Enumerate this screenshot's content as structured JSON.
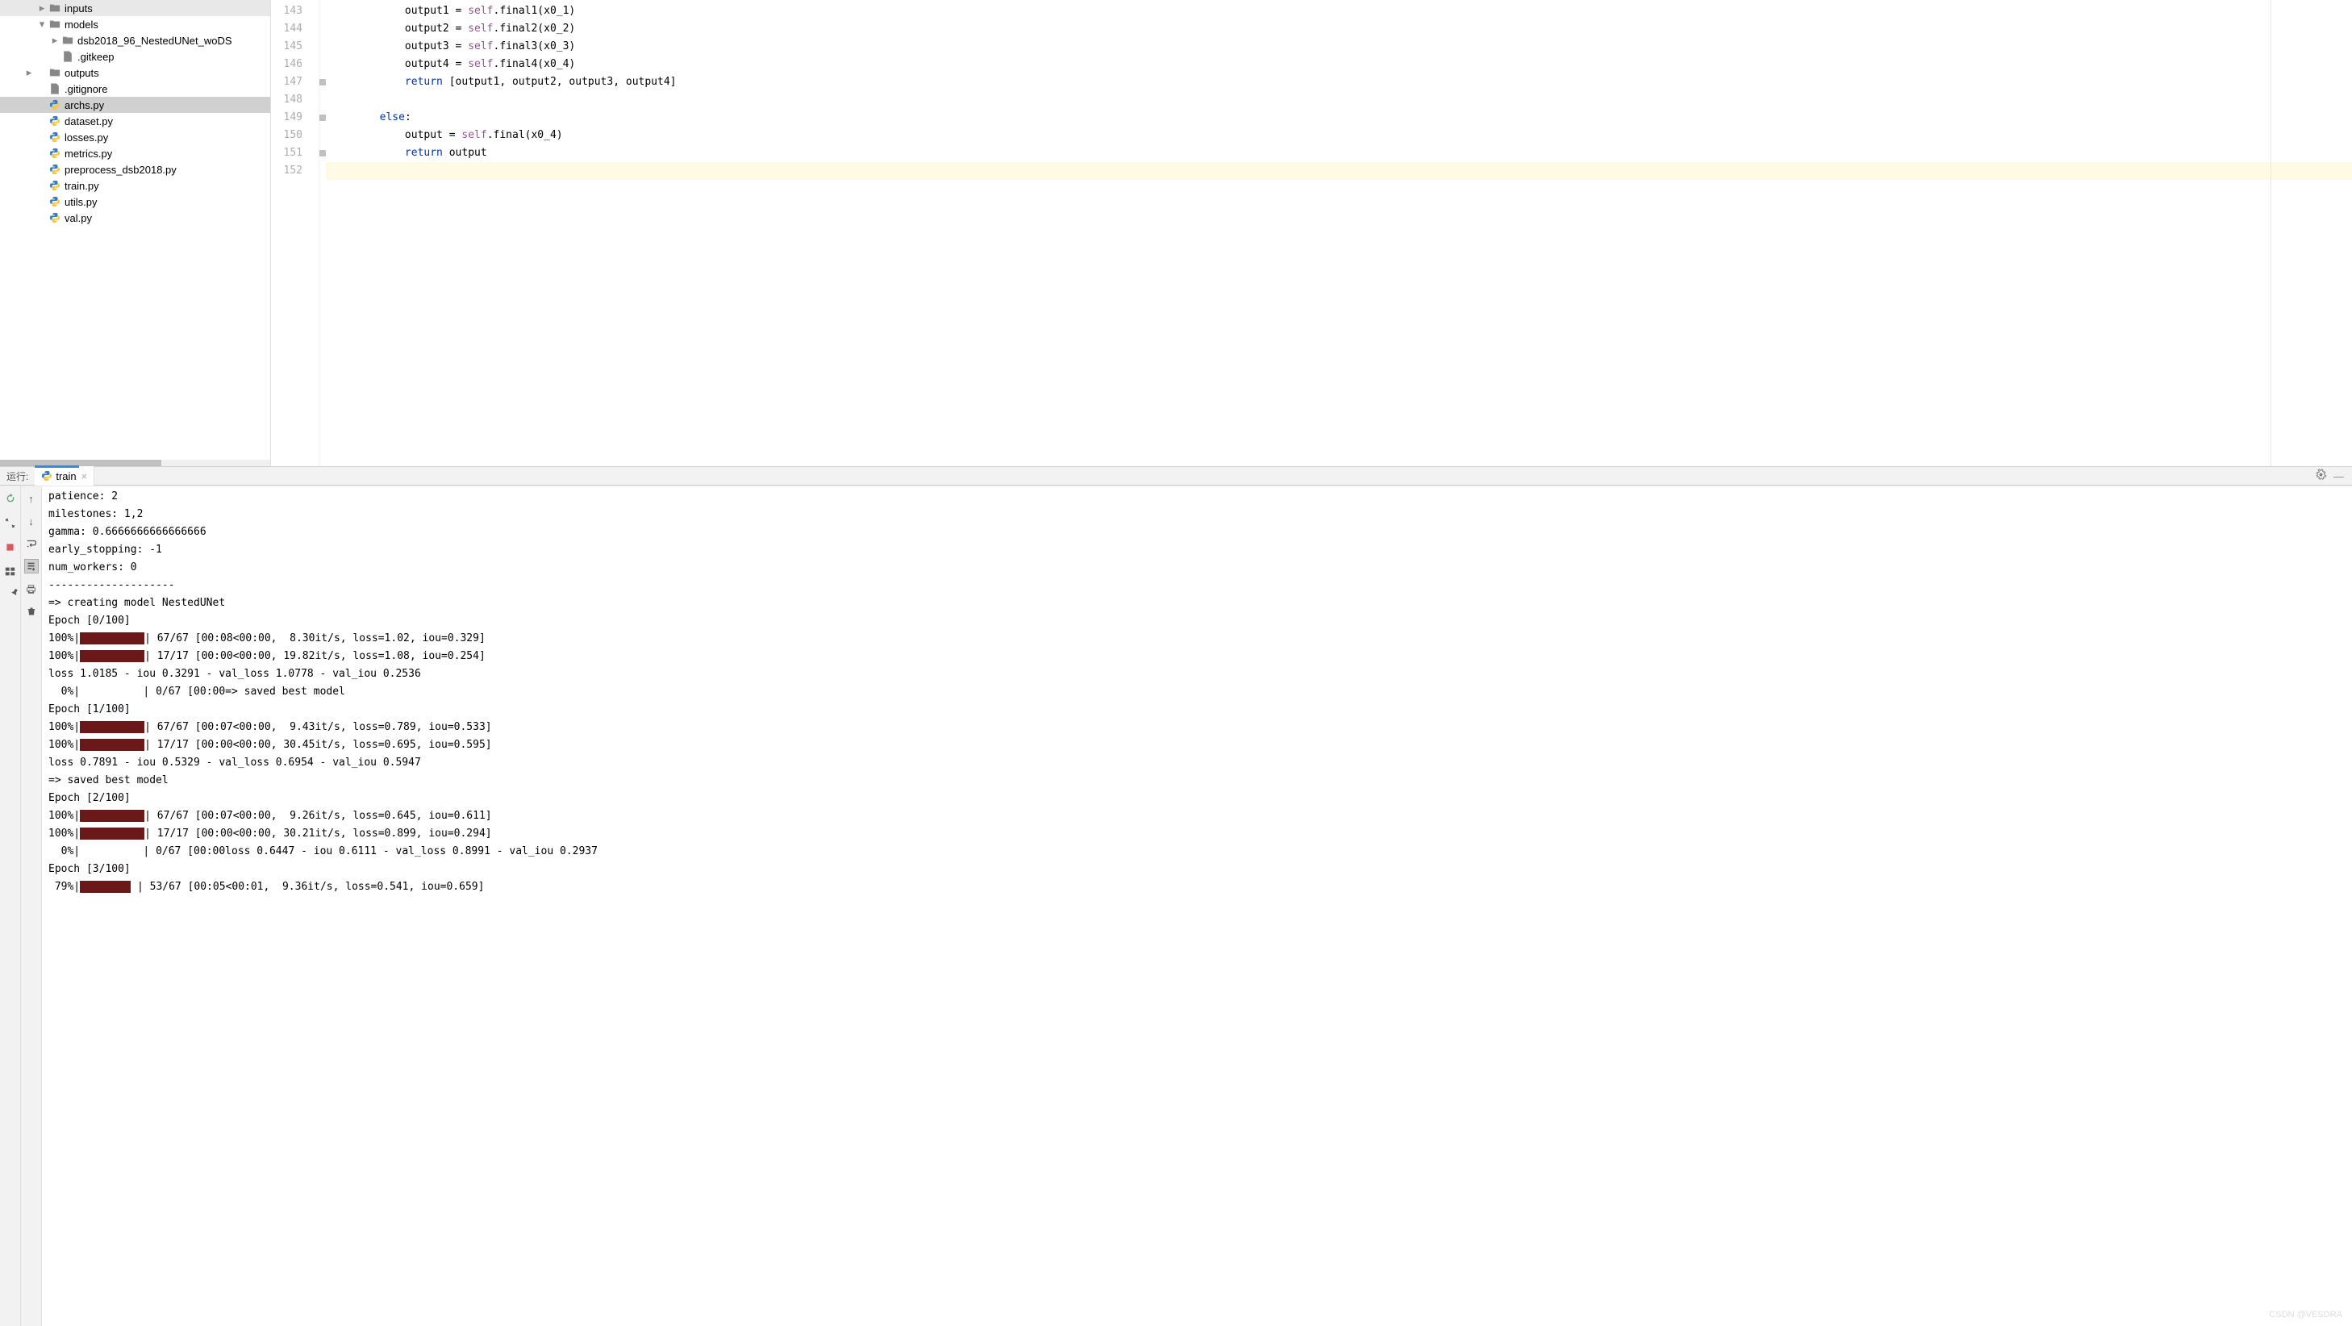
{
  "sidebar": {
    "items": [
      {
        "label": "inputs",
        "type": "folder",
        "indent": 2,
        "chevron": "right"
      },
      {
        "label": "models",
        "type": "folder",
        "indent": 2,
        "chevron": "down"
      },
      {
        "label": "dsb2018_96_NestedUNet_woDS",
        "type": "folder",
        "indent": 3,
        "chevron": "right"
      },
      {
        "label": ".gitkeep",
        "type": "file",
        "indent": 3
      },
      {
        "label": "outputs",
        "type": "folder",
        "indent": 2,
        "chevron": "right-outer"
      },
      {
        "label": ".gitignore",
        "type": "file",
        "indent": 2
      },
      {
        "label": "archs.py",
        "type": "py",
        "indent": 2,
        "selected": true
      },
      {
        "label": "dataset.py",
        "type": "py",
        "indent": 2
      },
      {
        "label": "losses.py",
        "type": "py",
        "indent": 2
      },
      {
        "label": "metrics.py",
        "type": "py",
        "indent": 2
      },
      {
        "label": "preprocess_dsb2018.py",
        "type": "py",
        "indent": 2
      },
      {
        "label": "train.py",
        "type": "py",
        "indent": 2
      },
      {
        "label": "utils.py",
        "type": "py",
        "indent": 2
      },
      {
        "label": "val.py",
        "type": "py",
        "indent": 2
      }
    ]
  },
  "editor": {
    "lines": [
      {
        "num": "143",
        "indent": "            ",
        "tokens": [
          {
            "t": "output1 = ",
            "c": "plain"
          },
          {
            "t": "self",
            "c": "self"
          },
          {
            "t": ".final1(x0_1)",
            "c": "plain"
          }
        ]
      },
      {
        "num": "144",
        "indent": "            ",
        "tokens": [
          {
            "t": "output2 = ",
            "c": "plain"
          },
          {
            "t": "self",
            "c": "self"
          },
          {
            "t": ".final2(x0_2)",
            "c": "plain"
          }
        ]
      },
      {
        "num": "145",
        "indent": "            ",
        "tokens": [
          {
            "t": "output3 = ",
            "c": "plain"
          },
          {
            "t": "self",
            "c": "self"
          },
          {
            "t": ".final3(x0_3)",
            "c": "plain"
          }
        ]
      },
      {
        "num": "146",
        "indent": "            ",
        "tokens": [
          {
            "t": "output4 = ",
            "c": "plain"
          },
          {
            "t": "self",
            "c": "self"
          },
          {
            "t": ".final4(x0_4)",
            "c": "plain"
          }
        ]
      },
      {
        "num": "147",
        "indent": "            ",
        "tokens": [
          {
            "t": "return ",
            "c": "kw"
          },
          {
            "t": "[output1, output2, output3, output4]",
            "c": "plain"
          }
        ],
        "marker": true
      },
      {
        "num": "148",
        "indent": "",
        "tokens": []
      },
      {
        "num": "149",
        "indent": "        ",
        "tokens": [
          {
            "t": "else",
            "c": "kw"
          },
          {
            "t": ":",
            "c": "plain"
          }
        ],
        "marker": true
      },
      {
        "num": "150",
        "indent": "            ",
        "tokens": [
          {
            "t": "output = ",
            "c": "plain"
          },
          {
            "t": "self",
            "c": "self"
          },
          {
            "t": ".final(x0_4)",
            "c": "plain"
          }
        ]
      },
      {
        "num": "151",
        "indent": "            ",
        "tokens": [
          {
            "t": "return ",
            "c": "kw"
          },
          {
            "t": "output",
            "c": "plain"
          }
        ],
        "marker": true
      },
      {
        "num": "152",
        "indent": "",
        "tokens": [],
        "highlight": true
      }
    ]
  },
  "run": {
    "label": "运行:",
    "tab_name": "train"
  },
  "console": [
    {
      "type": "text",
      "text": "patience: 2"
    },
    {
      "type": "text",
      "text": "milestones: 1,2"
    },
    {
      "type": "text",
      "text": "gamma: 0.6666666666666666"
    },
    {
      "type": "text",
      "text": "early_stopping: -1"
    },
    {
      "type": "text",
      "text": "num_workers: 0"
    },
    {
      "type": "text",
      "text": "--------------------"
    },
    {
      "type": "text",
      "text": "=> creating model NestedUNet"
    },
    {
      "type": "text",
      "text": "Epoch [0/100]"
    },
    {
      "type": "progress",
      "pct": "100%",
      "width": 80,
      "stats": "| 67/67 [00:08<00:00,  8.30it/s, loss=1.02, iou=0.329]"
    },
    {
      "type": "progress",
      "pct": "100%",
      "width": 80,
      "stats": "| 17/17 [00:00<00:00, 19.82it/s, loss=1.08, iou=0.254]"
    },
    {
      "type": "text",
      "text": "loss 1.0185 - iou 0.3291 - val_loss 1.0778 - val_iou 0.2536"
    },
    {
      "type": "progress",
      "pct": "  0%",
      "width": 0,
      "stats": "| 0/67 [00:00<?, ?it/s]",
      "after": "=> saved best model",
      "pad": "          "
    },
    {
      "type": "text",
      "text": "Epoch [1/100]"
    },
    {
      "type": "progress",
      "pct": "100%",
      "width": 80,
      "stats": "| 67/67 [00:07<00:00,  9.43it/s, loss=0.789, iou=0.533]"
    },
    {
      "type": "progress",
      "pct": "100%",
      "width": 80,
      "stats": "| 17/17 [00:00<00:00, 30.45it/s, loss=0.695, iou=0.595]"
    },
    {
      "type": "text",
      "text": "loss 0.7891 - iou 0.5329 - val_loss 0.6954 - val_iou 0.5947"
    },
    {
      "type": "text",
      "text": "=> saved best model"
    },
    {
      "type": "text",
      "text": "Epoch [2/100]"
    },
    {
      "type": "progress",
      "pct": "100%",
      "width": 80,
      "stats": "| 67/67 [00:07<00:00,  9.26it/s, loss=0.645, iou=0.611]"
    },
    {
      "type": "progress",
      "pct": "100%",
      "width": 80,
      "stats": "| 17/17 [00:00<00:00, 30.21it/s, loss=0.899, iou=0.294]"
    },
    {
      "type": "progress",
      "pct": "  0%",
      "width": 0,
      "stats": "| 0/67 [00:00<?, ?it/s]",
      "after": "loss 0.6447 - iou 0.6111 - val_loss 0.8991 - val_iou 0.2937",
      "pad": "          "
    },
    {
      "type": "text",
      "text": "Epoch [3/100]"
    },
    {
      "type": "progress",
      "pct": " 79%",
      "width": 63,
      "stats": " | 53/67 [00:05<00:01,  9.36it/s, loss=0.541, iou=0.659]",
      "pad17": true
    }
  ],
  "watermark": "CSDN @VESDRA"
}
